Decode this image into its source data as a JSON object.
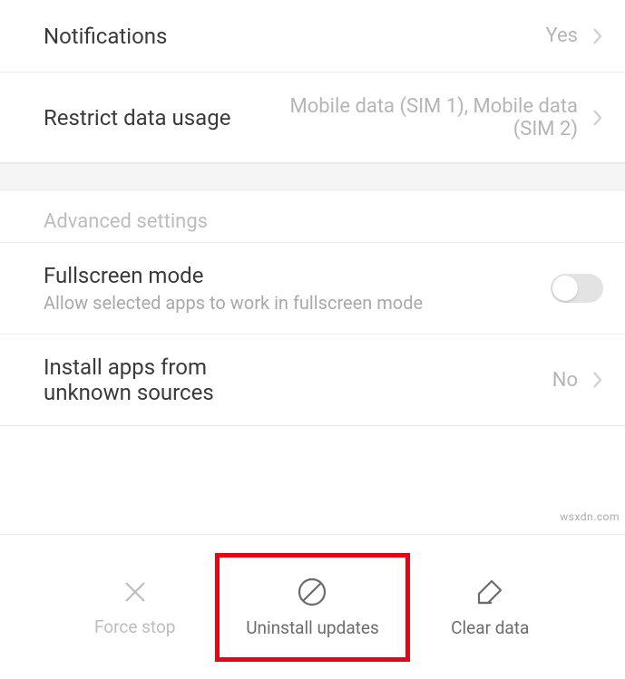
{
  "rows": {
    "notifications": {
      "title": "Notifications",
      "value": "Yes"
    },
    "restrict": {
      "title": "Restrict data usage",
      "value": "Mobile data (SIM 1), Mobile data (SIM 2)"
    },
    "fullscreen": {
      "title": "Fullscreen mode",
      "subtitle": "Allow selected apps to work in fullscreen mode"
    },
    "install": {
      "title": "Install apps from unknown sources",
      "value": "No"
    }
  },
  "section_header": "Advanced settings",
  "actions": {
    "force_stop": "Force stop",
    "uninstall": "Uninstall updates",
    "clear": "Clear data"
  },
  "watermark": "wsxdn.com"
}
